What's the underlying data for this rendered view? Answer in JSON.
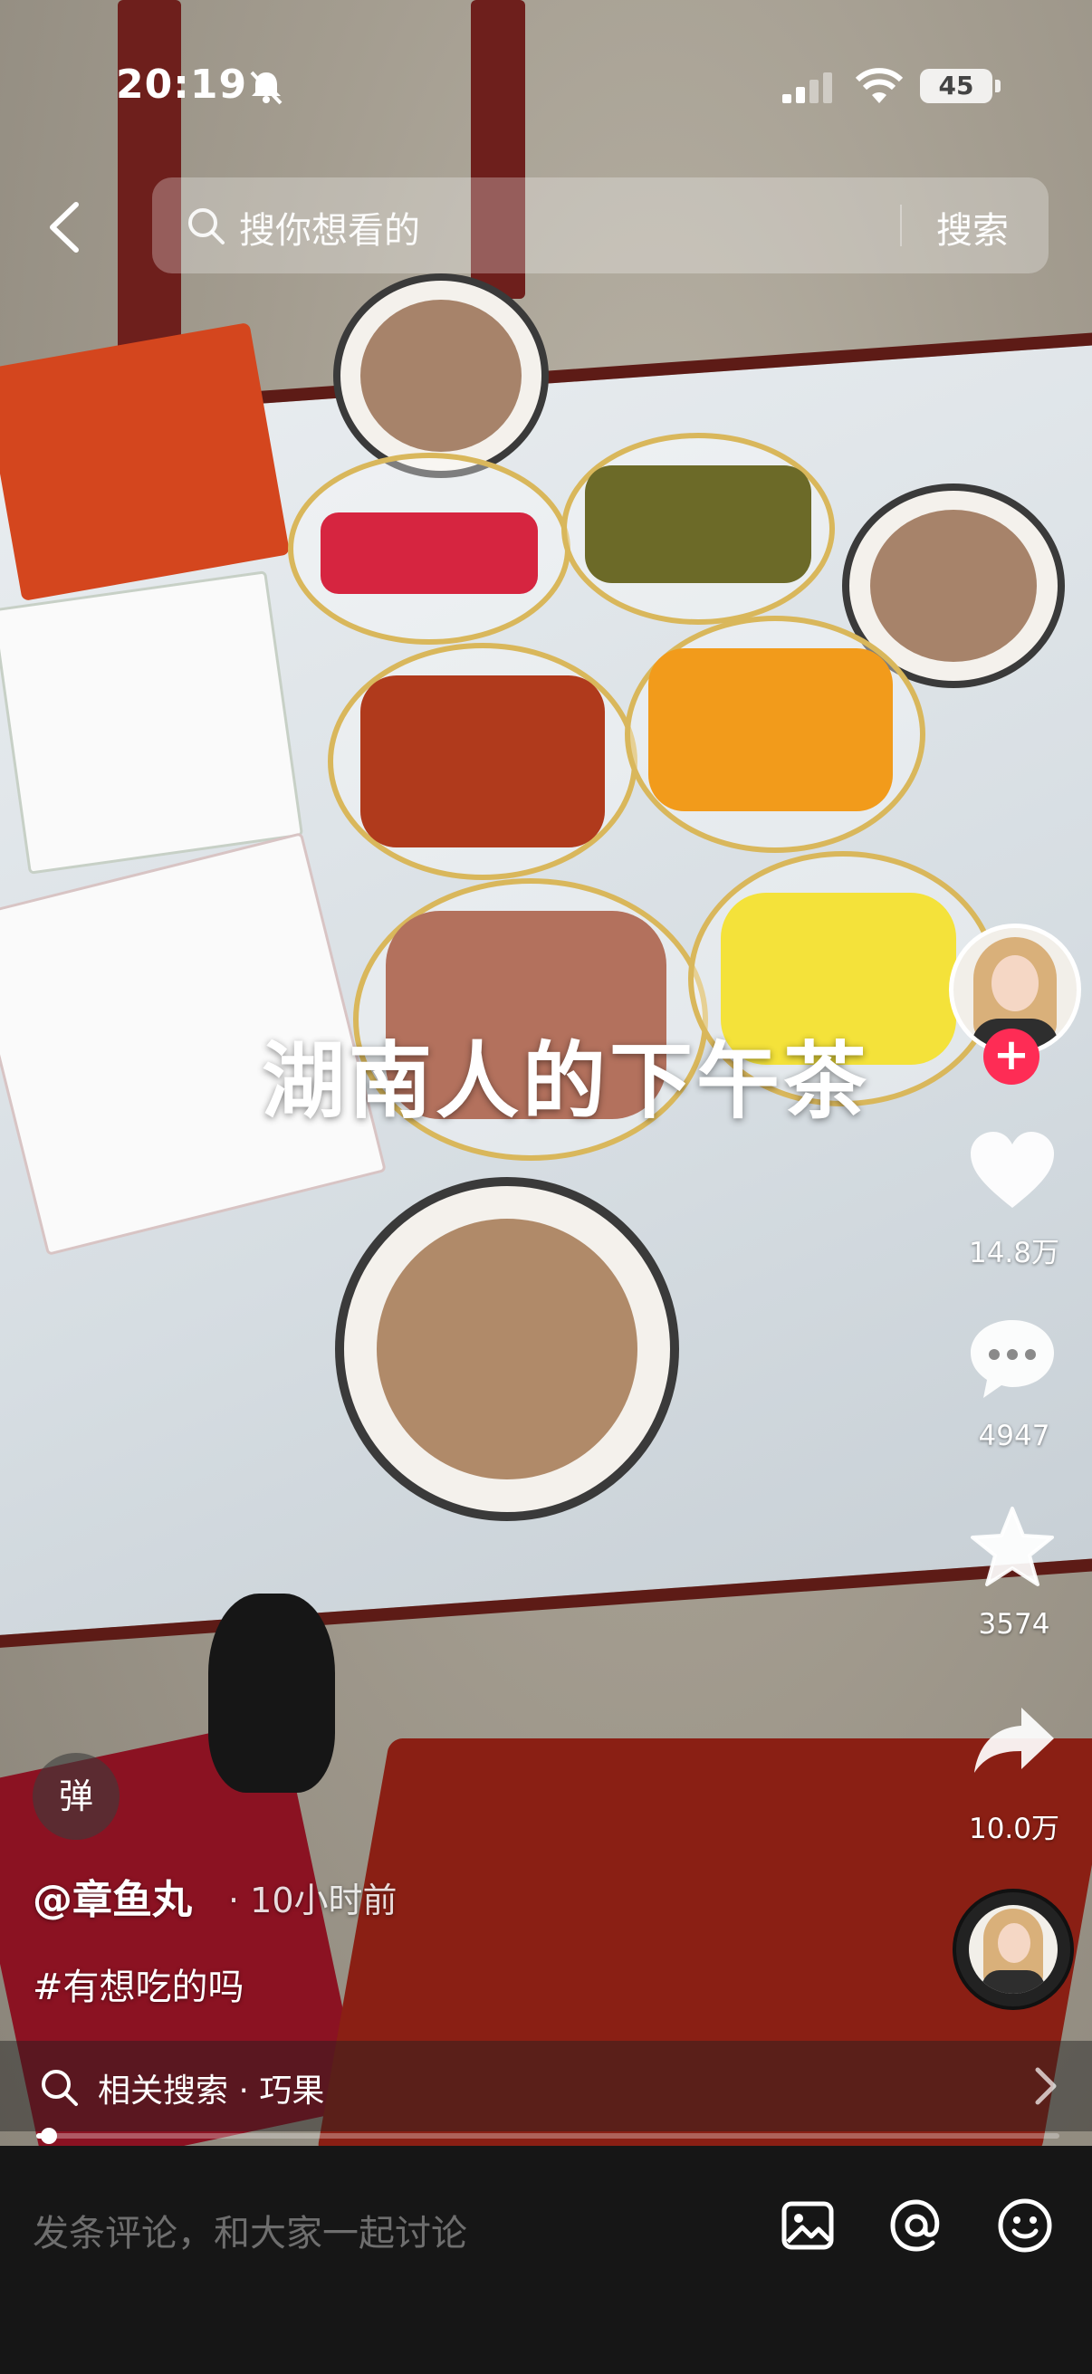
{
  "status_bar": {
    "time": "20:19",
    "battery": "45",
    "icons": [
      "mute-bell-icon",
      "cellular-signal-icon",
      "wifi-icon",
      "battery-icon"
    ]
  },
  "search": {
    "placeholder": "搜你想看的",
    "button_label": "搜索"
  },
  "video": {
    "caption": "湖南人的下午茶"
  },
  "actions": {
    "likes": "14.8万",
    "comments": "4947",
    "favorites": "3574",
    "shares": "10.0万"
  },
  "author": {
    "name": "@章鱼丸",
    "posted": "· 10小时前",
    "hashtag": "#有想吃的吗"
  },
  "danmu": {
    "label": "弹"
  },
  "related": {
    "label": "相关搜索 · 巧果"
  },
  "progress": {
    "fraction": 0.01
  },
  "comment_bar": {
    "placeholder": "发条评论，和大家一起讨论",
    "icons": [
      "image-icon",
      "at-icon",
      "emoji-icon"
    ]
  },
  "colors": {
    "accent": "#fe2c55",
    "comment_bar_bg": "#161616"
  }
}
